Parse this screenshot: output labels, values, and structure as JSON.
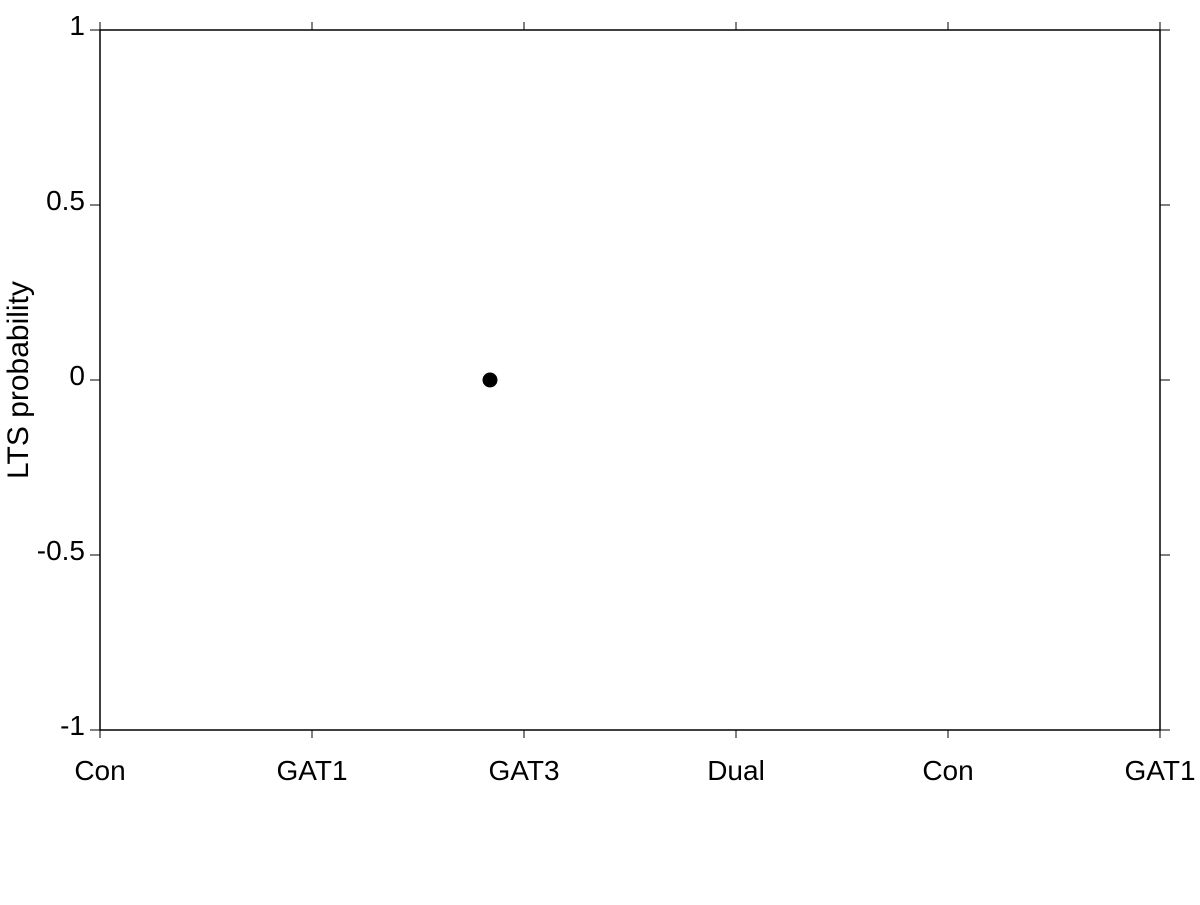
{
  "chart": {
    "title": "",
    "y_axis_label": "LTS probability",
    "x_axis_labels": [
      "Con",
      "GAT1",
      "GAT3",
      "Dual",
      "Con",
      "GAT1"
    ],
    "y_axis_ticks": [
      "1",
      "0.5",
      "0",
      "-0.5",
      "-1"
    ],
    "y_min": -1,
    "y_max": 1,
    "data_point": {
      "x_label": "GAT3",
      "y_value": 0,
      "x_index": 2
    },
    "colors": {
      "axis": "#000000",
      "grid_line": "#cccccc",
      "tick_label": "#000000",
      "data_point": "#000000"
    }
  }
}
